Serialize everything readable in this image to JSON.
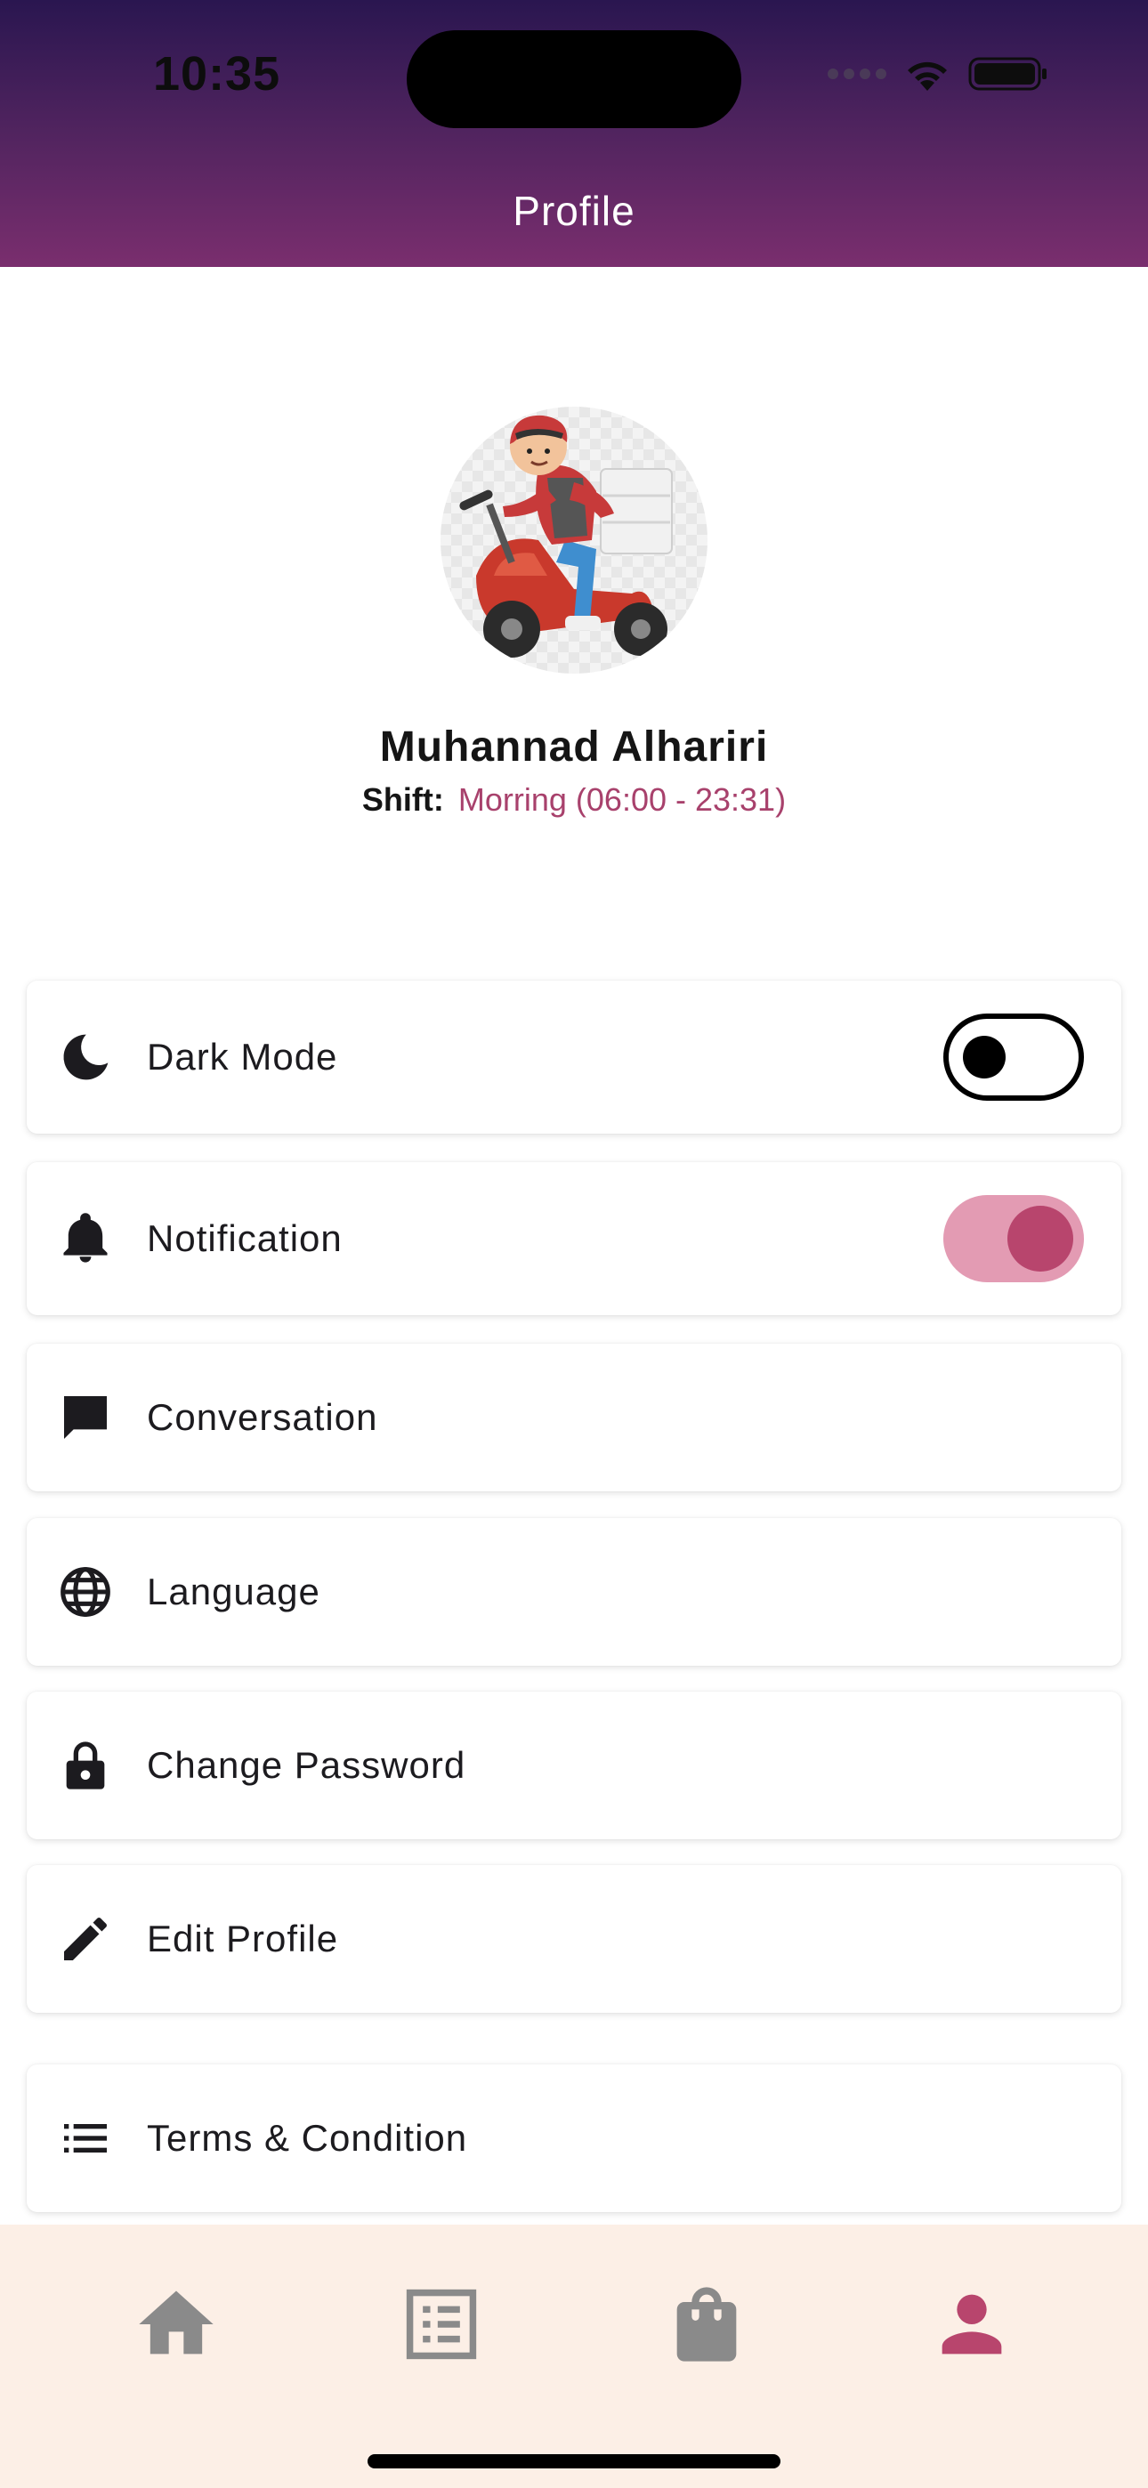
{
  "status_bar": {
    "time": "10:35"
  },
  "header": {
    "title": "Profile"
  },
  "profile": {
    "name": "Muhannad Alhariri",
    "shift_label": "Shift:",
    "shift_value": "Morring (06:00 - 23:31)"
  },
  "settings": {
    "dark_mode": {
      "label": "Dark Mode",
      "icon": "moon-icon",
      "enabled": false
    },
    "notification": {
      "label": "Notification",
      "icon": "bell-icon",
      "enabled": true
    },
    "conversation": {
      "label": "Conversation",
      "icon": "chat-icon"
    },
    "language": {
      "label": "Language",
      "icon": "globe-icon"
    },
    "change_password": {
      "label": "Change Password",
      "icon": "lock-icon"
    },
    "edit_profile": {
      "label": "Edit Profile",
      "icon": "pencil-icon"
    },
    "terms": {
      "label": "Terms & Condition",
      "icon": "list-icon"
    }
  },
  "bottom_nav": {
    "items": [
      {
        "icon": "home-icon",
        "active": false
      },
      {
        "icon": "orders-list-icon",
        "active": false
      },
      {
        "icon": "shopping-bag-icon",
        "active": false
      },
      {
        "icon": "person-icon",
        "active": true
      }
    ]
  },
  "colors": {
    "header_top": "#2a1650",
    "header_bottom": "#7a2e6e",
    "accent": "#b8456d",
    "accent_light": "#e39bb3",
    "nav_background": "#fcefe6",
    "nav_inactive": "#8a8a8a"
  }
}
